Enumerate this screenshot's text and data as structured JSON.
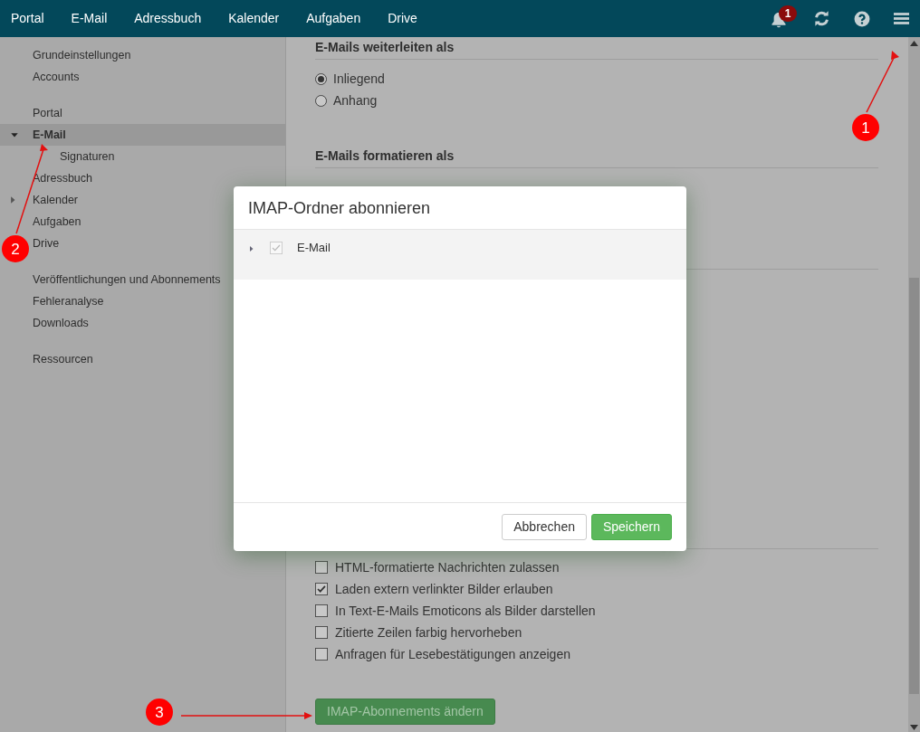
{
  "top_nav": {
    "items": [
      {
        "label": "Portal"
      },
      {
        "label": "E-Mail"
      },
      {
        "label": "Adressbuch"
      },
      {
        "label": "Kalender"
      },
      {
        "label": "Aufgaben"
      },
      {
        "label": "Drive"
      }
    ],
    "notification_count": "1"
  },
  "sidebar": {
    "groups": [
      [
        {
          "label": "Grundeinstellungen",
          "selected": false
        },
        {
          "label": "Accounts",
          "selected": false
        }
      ],
      [
        {
          "label": "Portal",
          "selected": false
        },
        {
          "label": "E-Mail",
          "selected": true,
          "expanded": true,
          "children": [
            {
              "label": "Signaturen",
              "selected": false
            }
          ]
        },
        {
          "label": "Adressbuch",
          "selected": false
        },
        {
          "label": "Kalender",
          "selected": false,
          "expanded": false
        },
        {
          "label": "Aufgaben",
          "selected": false
        },
        {
          "label": "Drive",
          "selected": false
        }
      ],
      [
        {
          "label": "Veröffentlichungen und Abonnements",
          "selected": false
        },
        {
          "label": "Fehleranalyse",
          "selected": false
        },
        {
          "label": "Downloads",
          "selected": false
        }
      ],
      [
        {
          "label": "Ressourcen",
          "selected": false
        }
      ]
    ]
  },
  "content": {
    "sections": [
      {
        "heading": "E-Mails weiterleiten als",
        "options": [
          {
            "label": "Inliegend",
            "selected": true
          },
          {
            "label": "Anhang",
            "selected": false
          }
        ]
      },
      {
        "heading": "E-Mails formatieren als"
      }
    ],
    "checkboxes": [
      {
        "label": "HTML-formatierte Nachrichten zulassen",
        "checked": false
      },
      {
        "label": "Laden extern verlinkter Bilder erlauben",
        "checked": true
      },
      {
        "label": "In Text-E-Mails Emoticons als Bilder darstellen",
        "checked": false
      },
      {
        "label": "Zitierte Zeilen farbig hervorheben",
        "checked": false
      },
      {
        "label": "Anfragen für Lesebestätigungen anzeigen",
        "checked": false
      }
    ],
    "button": "IMAP-Abonnements ändern"
  },
  "dialog": {
    "title": "IMAP-Ordner abonnieren",
    "tree": [
      {
        "label": "E-Mail",
        "checked": true,
        "disabled": true,
        "expanded": false
      }
    ],
    "buttons": [
      {
        "label": "Abbrechen",
        "kind": "default"
      },
      {
        "label": "Speichern",
        "kind": "primary"
      }
    ]
  },
  "annotations": [
    {
      "number": "1"
    },
    {
      "number": "2"
    },
    {
      "number": "3"
    }
  ]
}
